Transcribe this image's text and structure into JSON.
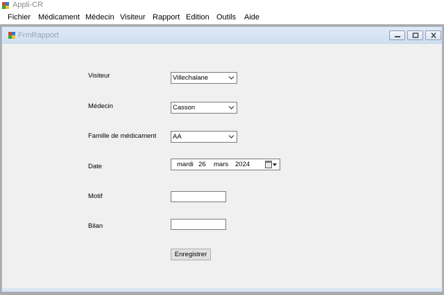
{
  "app": {
    "title": "Appli-CR"
  },
  "menu": [
    {
      "label": "Fichier"
    },
    {
      "label": "Médicament"
    },
    {
      "label": "Médecin"
    },
    {
      "label": "Visiteur"
    },
    {
      "label": "Rapport"
    },
    {
      "label": "Edition"
    },
    {
      "label": "Outils"
    },
    {
      "label": "Aide"
    }
  ],
  "child_window": {
    "title": "FrmRapport"
  },
  "form": {
    "visiteur": {
      "label": "Visiteur",
      "value": "Villechalane"
    },
    "medecin": {
      "label": "Médecin",
      "value": "Casson"
    },
    "famille": {
      "label": "Famille de médicament",
      "value": "AA"
    },
    "date": {
      "label": "Date",
      "weekday": "mardi",
      "day": "26",
      "month": "mars",
      "year": "2024"
    },
    "motif": {
      "label": "Motif",
      "value": ""
    },
    "bilan": {
      "label": "Bilan",
      "value": ""
    },
    "submit_label": "Enregistrer"
  },
  "icons": {
    "app": "app-icon",
    "child": "form-icon"
  }
}
